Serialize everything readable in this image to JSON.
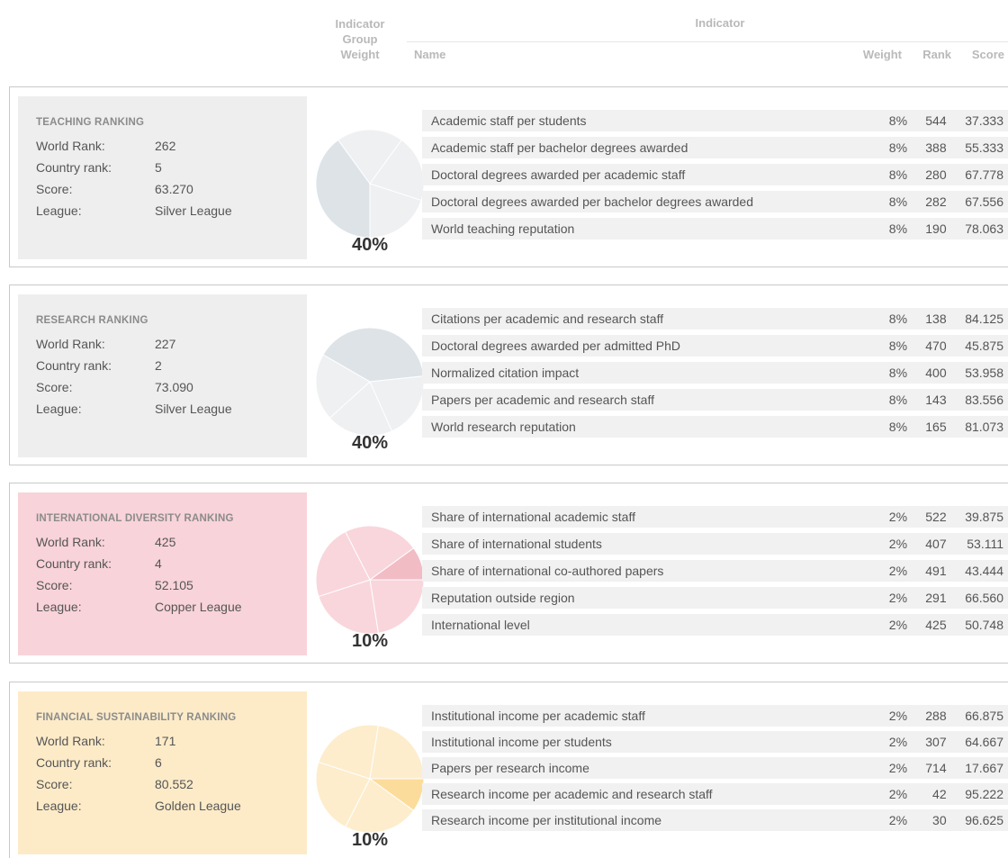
{
  "headers": {
    "group_weight": [
      "Indicator",
      "Group",
      "Weight"
    ],
    "indicator": "Indicator",
    "name": "Name",
    "weight": "Weight",
    "rank": "Rank",
    "score": "Score"
  },
  "summary_labels": {
    "world_rank": "World Rank:",
    "country_rank": "Country rank:",
    "score": "Score:",
    "league": "League:"
  },
  "sections": [
    {
      "title": "TEACHING RANKING",
      "world_rank": "262",
      "country_rank": "5",
      "score": "63.270",
      "league": "Silver League",
      "group_weight": "40%",
      "color": "#eeeeee",
      "pie_colors": {
        "light": "#eef0f2",
        "dark": "#dde3e7"
      },
      "indicators": [
        {
          "name": "Academic staff per students",
          "weight": "8%",
          "rank": "544",
          "score": "37.333"
        },
        {
          "name": "Academic staff per bachelor degrees awarded",
          "weight": "8%",
          "rank": "388",
          "score": "55.333"
        },
        {
          "name": "Doctoral degrees awarded per academic staff",
          "weight": "8%",
          "rank": "280",
          "score": "67.778"
        },
        {
          "name": "Doctoral degrees awarded per bachelor degrees awarded",
          "weight": "8%",
          "rank": "282",
          "score": "67.556"
        },
        {
          "name": "World teaching reputation",
          "weight": "8%",
          "rank": "190",
          "score": "78.063"
        }
      ]
    },
    {
      "title": "RESEARCH RANKING",
      "world_rank": "227",
      "country_rank": "2",
      "score": "73.090",
      "league": "Silver League",
      "group_weight": "40%",
      "color": "#eeeeee",
      "pie_colors": {
        "light": "#eef0f2",
        "dark": "#dde3e7"
      },
      "indicators": [
        {
          "name": "Citations per academic and research staff",
          "weight": "8%",
          "rank": "138",
          "score": "84.125"
        },
        {
          "name": "Doctoral degrees awarded per admitted PhD",
          "weight": "8%",
          "rank": "470",
          "score": "45.875"
        },
        {
          "name": "Normalized citation impact",
          "weight": "8%",
          "rank": "400",
          "score": "53.958"
        },
        {
          "name": "Papers per academic and research staff",
          "weight": "8%",
          "rank": "143",
          "score": "83.556"
        },
        {
          "name": "World research reputation",
          "weight": "8%",
          "rank": "165",
          "score": "81.073"
        }
      ]
    },
    {
      "title": "INTERNATIONAL DIVERSITY RANKING",
      "world_rank": "425",
      "country_rank": "4",
      "score": "52.105",
      "league": "Copper League",
      "group_weight": "10%",
      "color": "#f8d3d9",
      "pie_colors": {
        "light": "#f9d6dc",
        "dark": "#f2bcc5"
      },
      "indicators": [
        {
          "name": "Share of international academic staff",
          "weight": "2%",
          "rank": "522",
          "score": "39.875"
        },
        {
          "name": "Share of international students",
          "weight": "2%",
          "rank": "407",
          "score": "53.111"
        },
        {
          "name": "Share of international co-authored papers",
          "weight": "2%",
          "rank": "491",
          "score": "43.444"
        },
        {
          "name": "Reputation outside region",
          "weight": "2%",
          "rank": "291",
          "score": "66.560"
        },
        {
          "name": "International level",
          "weight": "2%",
          "rank": "425",
          "score": "50.748"
        }
      ]
    },
    {
      "title": "FINANCIAL SUSTAINABILITY RANKING",
      "world_rank": "171",
      "country_rank": "6",
      "score": "80.552",
      "league": "Golden League",
      "group_weight": "10%",
      "color": "#fdebc8",
      "pie_colors": {
        "light": "#fdedcc",
        "dark": "#fcdc9a"
      },
      "indicators": [
        {
          "name": "Institutional income per academic staff",
          "weight": "2%",
          "rank": "288",
          "score": "66.875"
        },
        {
          "name": "Institutional income per students",
          "weight": "2%",
          "rank": "307",
          "score": "64.667"
        },
        {
          "name": "Papers per research income",
          "weight": "2%",
          "rank": "714",
          "score": "17.667"
        },
        {
          "name": "Research income per academic and research staff",
          "weight": "2%",
          "rank": "42",
          "score": "95.222"
        },
        {
          "name": "Research income per institutional income",
          "weight": "2%",
          "rank": "30",
          "score": "96.625"
        }
      ]
    }
  ]
}
